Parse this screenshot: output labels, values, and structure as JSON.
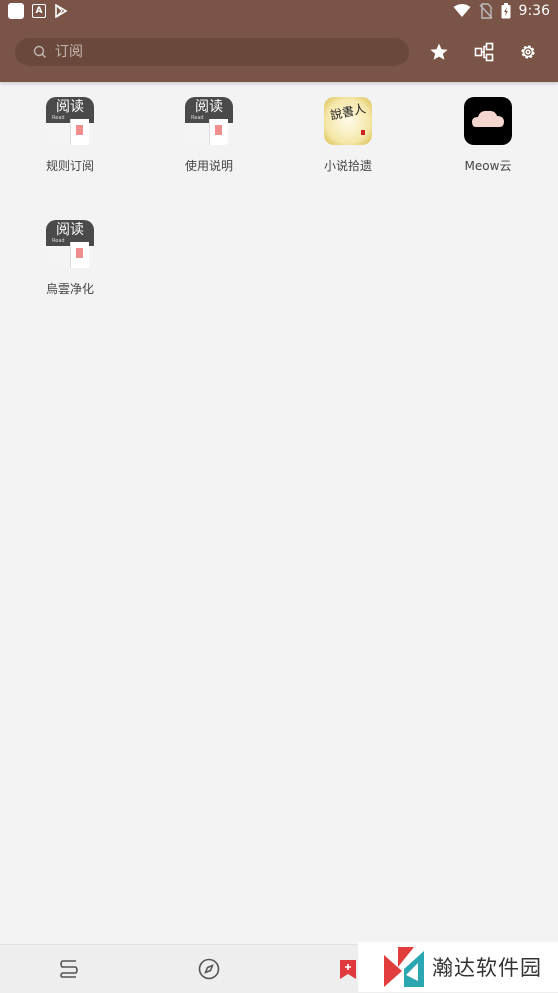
{
  "status_bar": {
    "time": "9:36"
  },
  "toolbar": {
    "search_placeholder": "订阅",
    "icons": [
      "star-icon",
      "share-nodes-icon",
      "gear-icon"
    ]
  },
  "subscriptions": [
    {
      "label": "规则订阅",
      "icon": "app-read-icon"
    },
    {
      "label": "使用说明",
      "icon": "app-read-icon"
    },
    {
      "label": "小说拾遗",
      "icon": "calligraphy-icon"
    },
    {
      "label": "Meow云",
      "icon": "cloud-icon"
    },
    {
      "label": "烏雲净化",
      "icon": "app-read-icon"
    }
  ],
  "app_icon_text": {
    "title": "阅读",
    "sub": "Read"
  },
  "calligraphy_text": "說書人",
  "bottom_nav": [
    "bookshelf-icon",
    "compass-icon",
    "subscription-icon"
  ],
  "watermark": {
    "text": "瀚达软件园"
  },
  "colors": {
    "primary": "#7a5446",
    "background": "#f3f3f3",
    "accent": "#e0393e"
  }
}
